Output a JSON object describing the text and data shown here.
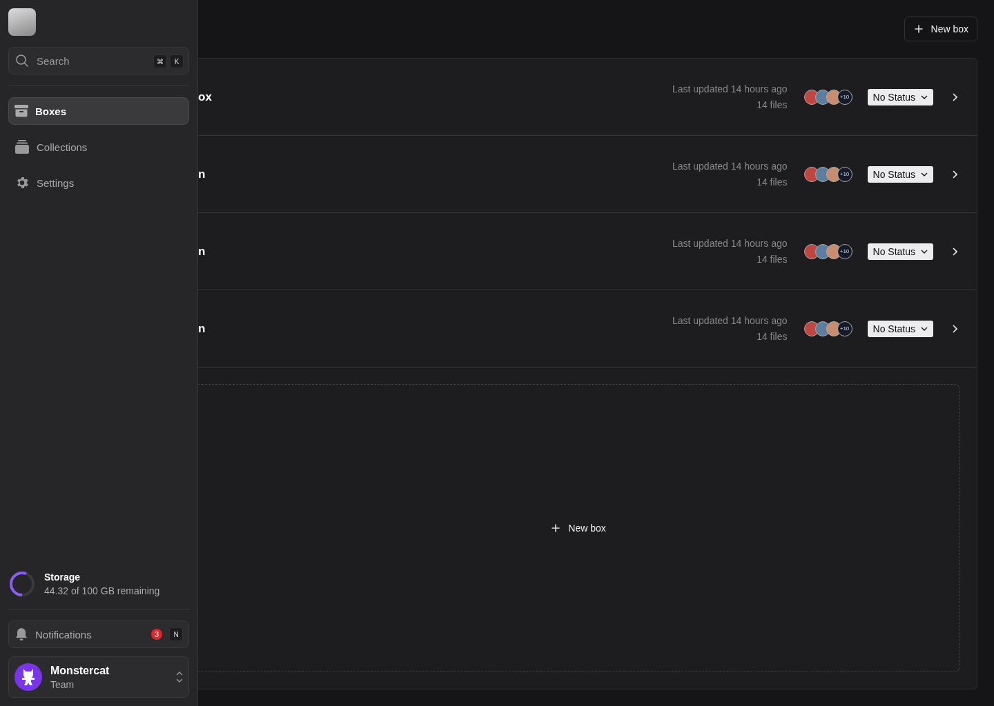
{
  "sidebar": {
    "search": {
      "placeholder": "Search",
      "shortcut": [
        "⌘",
        "K"
      ]
    },
    "nav": [
      {
        "label": "Boxes",
        "kind": "box",
        "selected": true
      },
      {
        "label": "Collections",
        "kind": "stack",
        "selected": false
      },
      {
        "label": "Settings",
        "kind": "gear",
        "selected": false
      }
    ],
    "storage": {
      "title": "Storage",
      "detail": "44.32 of 100 GB remaining",
      "level": 0.56
    },
    "notifications": {
      "label": "Notifications",
      "count": "3",
      "shortcut": "N"
    },
    "team": {
      "name": "Monstercat",
      "role": "Team"
    }
  },
  "header": {
    "new_button": "New box"
  },
  "rows": [
    {
      "title": "ox",
      "updated": "Last updated 14 hours ago",
      "files": "14 files",
      "more": "+10",
      "status": "No Status"
    },
    {
      "title": "n",
      "updated": "Last updated 14 hours ago",
      "files": "14 files",
      "more": "+10",
      "status": "No Status"
    },
    {
      "title": "n",
      "updated": "Last updated 14 hours ago",
      "files": "14 files",
      "more": "+10",
      "status": "No Status"
    },
    {
      "title": "n",
      "updated": "Last updated 14 hours ago",
      "files": "14 files",
      "more": "+10",
      "status": "No Status"
    }
  ],
  "dropzone": {
    "label": "New box"
  }
}
